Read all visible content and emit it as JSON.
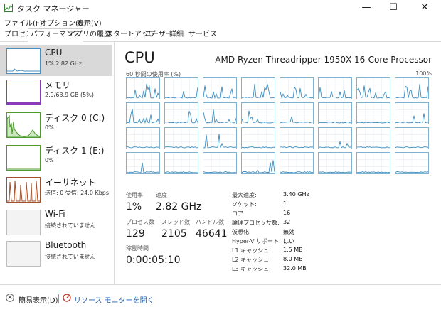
{
  "window": {
    "title": "タスク マネージャー",
    "minimize": "—",
    "maximize": "☐",
    "close": "✕"
  },
  "menu": [
    "ファイル(F)",
    "オプション(O)",
    "表示(V)"
  ],
  "tabs": [
    {
      "label": "プロセス",
      "active": false
    },
    {
      "label": "パフォーマンス",
      "active": true
    },
    {
      "label": "アプリの履歴",
      "active": false
    },
    {
      "label": "スタートアップ",
      "active": false
    },
    {
      "label": "ユーザー",
      "active": false
    },
    {
      "label": "詳細",
      "active": false
    },
    {
      "label": "サービス",
      "active": false
    }
  ],
  "sidebar": [
    {
      "title": "CPU",
      "sub": "1%  2.82 GHz",
      "selected": true,
      "color": "#4a8fc0",
      "fill": "#e8f2f9"
    },
    {
      "title": "メモリ",
      "sub": "2.9/63.9 GB (5%)",
      "selected": false,
      "color": "#8b3ab8",
      "fill": "#f4edf8"
    },
    {
      "title": "ディスク 0 (C:)",
      "sub": "0%",
      "selected": false,
      "color": "#4d9a2e",
      "fill": "#eef6ea"
    },
    {
      "title": "ディスク 1 (E:)",
      "sub": "0%",
      "selected": false,
      "color": "#4d9a2e",
      "fill": "#eef6ea"
    },
    {
      "title": "イーサネット",
      "sub": "送信: 0 受信: 24.0 Kbps",
      "selected": false,
      "color": "#a0522d",
      "fill": "#f8efe9"
    },
    {
      "title": "Wi-Fi",
      "sub": "接続されていません",
      "selected": false,
      "color": "#999999",
      "fill": "#ffffff"
    },
    {
      "title": "Bluetooth",
      "sub": "接続されていません",
      "selected": false,
      "color": "#999999",
      "fill": "#ffffff"
    }
  ],
  "main": {
    "title": "CPU",
    "processor": "AMD Ryzen Threadripper 1950X 16-Core Processor",
    "graph_label": "60 秒間の使用率 (%)",
    "graph_max": "100%",
    "core_count": 32,
    "line_color": "#3c8dbf",
    "stats": {
      "usage_label": "使用率",
      "usage_value": "1%",
      "speed_label": "速度",
      "speed_value": "2.82 GHz",
      "processes_label": "プロセス数",
      "processes_value": "129",
      "threads_label": "スレッド数",
      "threads_value": "2105",
      "handles_label": "ハンドル数",
      "handles_value": "46641",
      "uptime_label": "稼働時間",
      "uptime_value": "0:00:05:10"
    },
    "specs": [
      {
        "label": "最大速度:",
        "value": "3.40 GHz"
      },
      {
        "label": "ソケット:",
        "value": "1"
      },
      {
        "label": "コア:",
        "value": "16"
      },
      {
        "label": "論理プロセッサ数:",
        "value": "32"
      },
      {
        "label": "仮想化:",
        "value": "無効"
      },
      {
        "label": "Hyper-V サポート:",
        "value": "はい"
      },
      {
        "label": "L1 キャッシュ:",
        "value": "1.5 MB"
      },
      {
        "label": "L2 キャッシュ:",
        "value": "8.0 MB"
      },
      {
        "label": "L3 キャッシュ:",
        "value": "32.0 MB"
      }
    ]
  },
  "footer": {
    "fewer_details": "簡易表示(D)",
    "resource_monitor": "リソース モニターを開く"
  }
}
